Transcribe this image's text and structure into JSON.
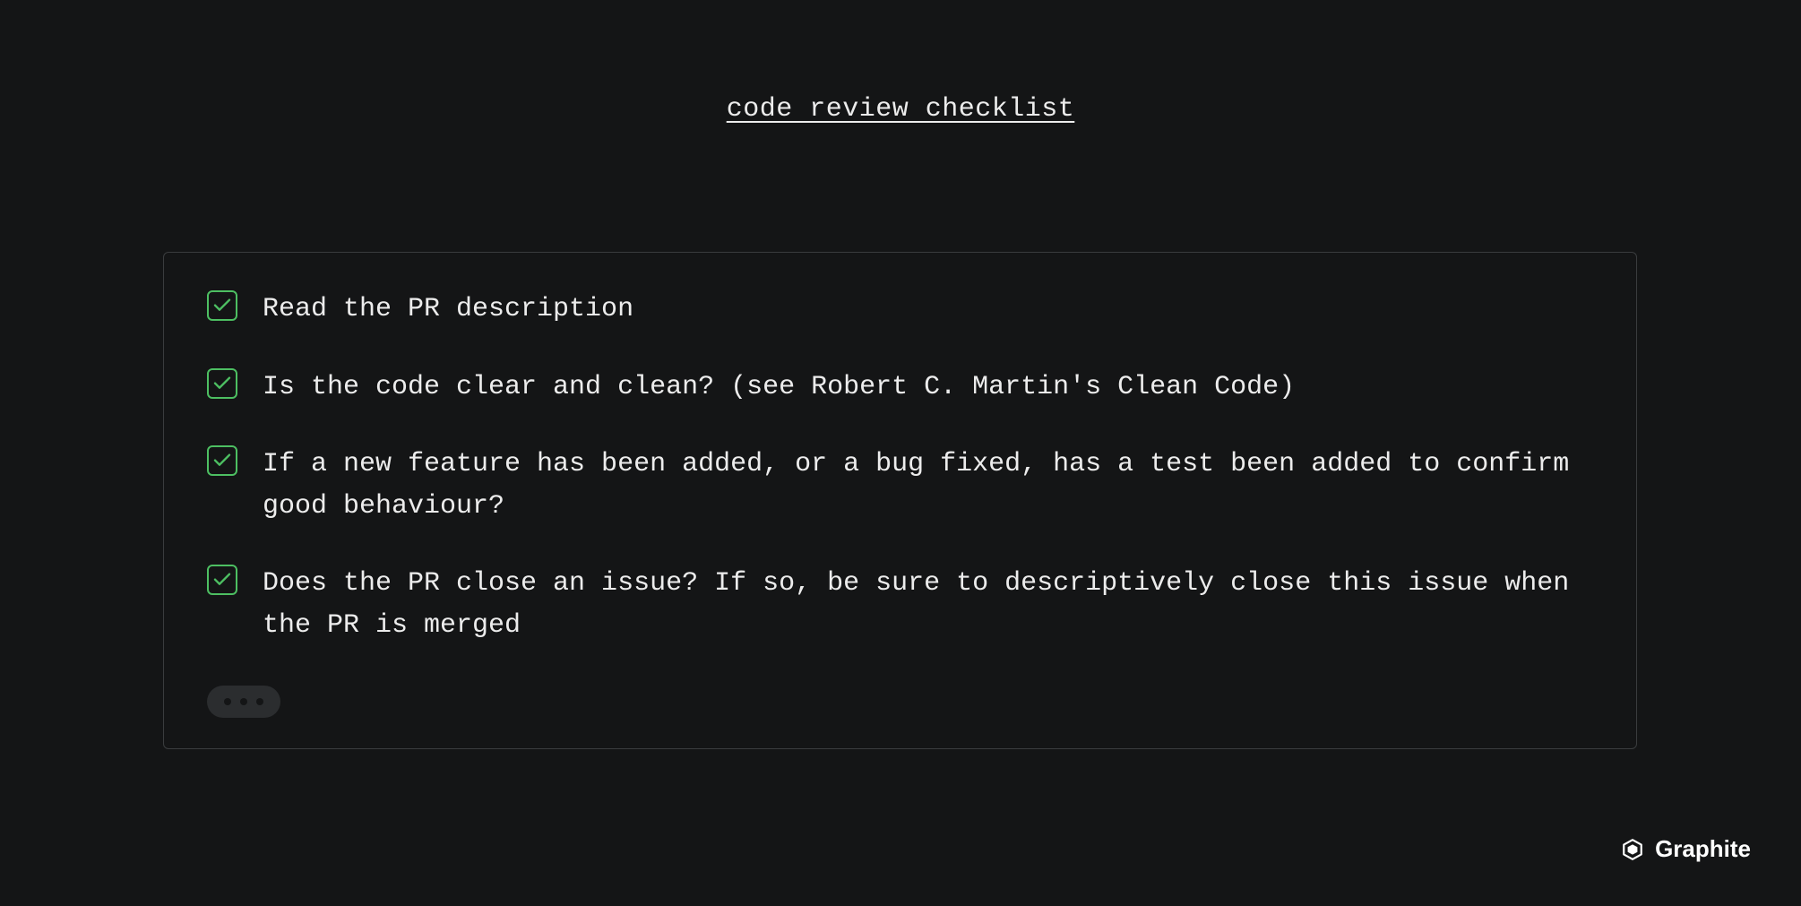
{
  "title": "code review checklist",
  "checklist": {
    "items": [
      {
        "label": "Read the PR description",
        "checked": true
      },
      {
        "label": "Is the code clear and clean? (see Robert C. Martin's Clean Code)",
        "checked": true
      },
      {
        "label": "If a new feature has been added, or a bug fixed, has a test been added to confirm good behaviour?",
        "checked": true
      },
      {
        "label": "Does the PR close an issue? If so, be sure to descriptively close this issue when the PR is merged",
        "checked": true
      }
    ]
  },
  "brand": {
    "name": "Graphite"
  },
  "colors": {
    "accent": "#4dbf62",
    "bg": "#141516",
    "panelBorder": "#3a3c3e",
    "text": "#ececec"
  }
}
